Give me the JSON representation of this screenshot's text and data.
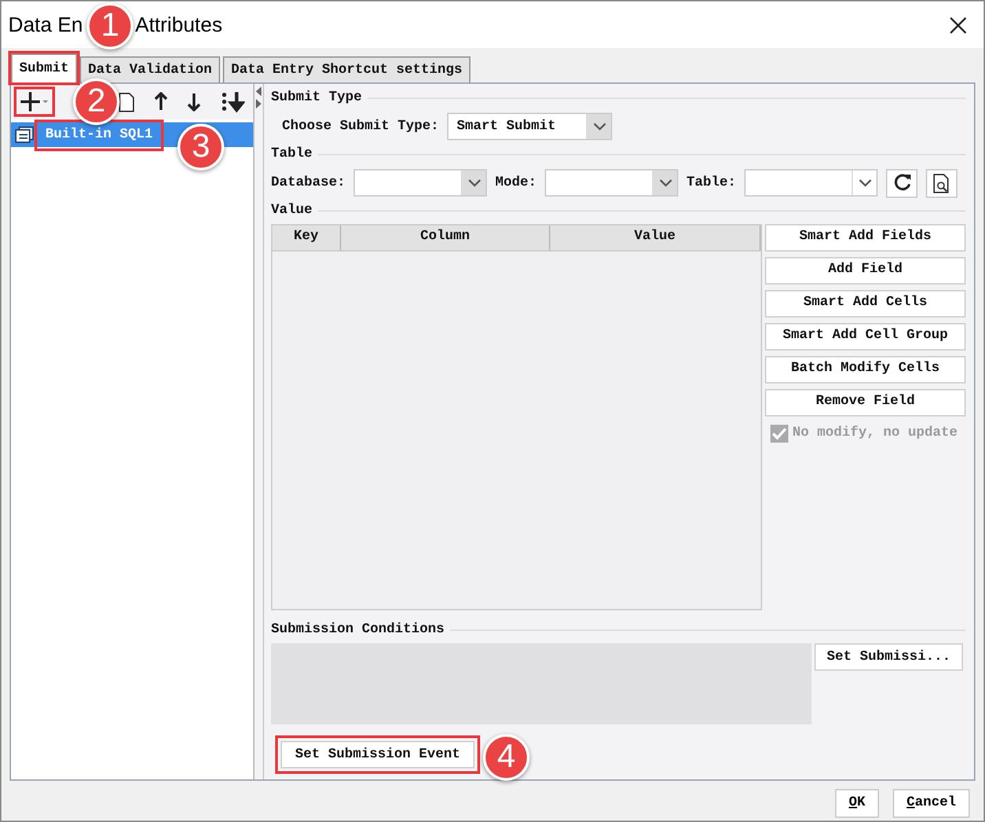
{
  "window": {
    "title_parts": [
      "Data En",
      "Attributes"
    ]
  },
  "tabs": [
    {
      "label": "Submit",
      "selected": true,
      "highlighted": true,
      "callout": "1"
    },
    {
      "label": "Data Validation",
      "selected": false,
      "highlighted": false
    },
    {
      "label": "Data Entry Shortcut settings",
      "selected": false,
      "highlighted": false
    }
  ],
  "toolbar": [
    {
      "kind": "add",
      "highlighted": true,
      "callout": "2"
    },
    {
      "kind": "paste",
      "highlighted": false
    },
    {
      "kind": "up",
      "highlighted": false
    },
    {
      "kind": "down",
      "highlighted": false
    },
    {
      "kind": "bottom",
      "highlighted": false
    }
  ],
  "tree": {
    "items": [
      {
        "label": "Built-in SQL1",
        "selected": true,
        "highlighted": true,
        "callout": "3"
      }
    ]
  },
  "submit_type": {
    "heading": "Submit Type",
    "label": "Choose Submit Type:",
    "value": "Smart Submit"
  },
  "table_section": {
    "heading": "Table",
    "fields": [
      {
        "label": "Database:"
      },
      {
        "label": "Mode:"
      },
      {
        "label": "Table:"
      }
    ]
  },
  "value_section": {
    "heading": "Value",
    "columns": [
      "Key",
      "Column",
      "Value"
    ],
    "buttons": [
      "Smart Add Fields",
      "Add Field",
      "Smart Add Cells",
      "Smart Add Cell Group",
      "Batch Modify Cells",
      "Remove Field"
    ],
    "no_modify": {
      "label": "No modify, no update",
      "checked": true,
      "disabled": true
    }
  },
  "conditions": {
    "heading": "Submission Conditions",
    "button": "Set Submissi..."
  },
  "event_button": {
    "label": "Set Submission Event",
    "highlighted": true,
    "callout": "4"
  },
  "footer_buttons": [
    "OK",
    "Cancel"
  ]
}
